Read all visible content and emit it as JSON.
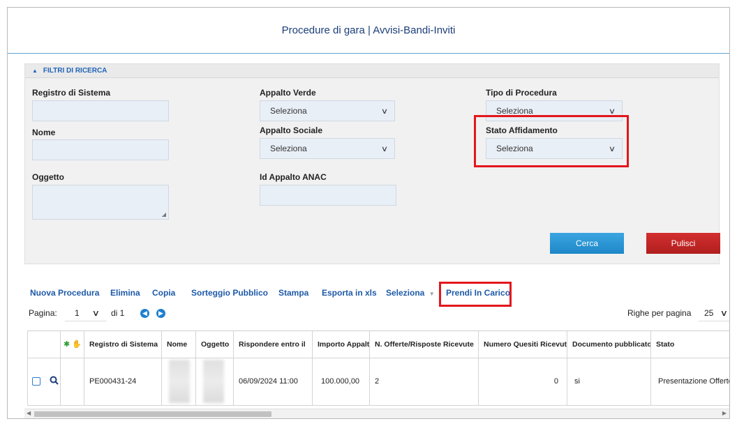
{
  "page_title": "Procedure di gara | Avvisi-Bandi-Inviti",
  "filters": {
    "header": "FILTRI DI RICERCA",
    "registro_label": "Registro di Sistema",
    "nome_label": "Nome",
    "oggetto_label": "Oggetto",
    "appalto_verde_label": "Appalto Verde",
    "appalto_verde_value": "Seleziona",
    "appalto_sociale_label": "Appalto Sociale",
    "appalto_sociale_value": "Seleziona",
    "id_anac_label": "Id Appalto ANAC",
    "tipo_procedura_label": "Tipo di Procedura",
    "tipo_procedura_value": "Seleziona",
    "stato_affidamento_label": "Stato Affidamento",
    "stato_affidamento_value": "Seleziona",
    "cerca_label": "Cerca",
    "pulisci_label": "Pulisci"
  },
  "toolbar": {
    "nuova": "Nuova Procedura",
    "elimina": "Elimina",
    "copia": "Copia",
    "sorteggio": "Sorteggio Pubblico",
    "stampa": "Stampa",
    "esporta": "Esporta in xls",
    "seleziona": "Seleziona",
    "prendi": "Prendi In Carico"
  },
  "pager": {
    "label": "Pagina:",
    "page": "1",
    "of": "di 1",
    "rows_label": "Righe per pagina",
    "rows_value": "25"
  },
  "table": {
    "columns": [
      "Registro di Sistema",
      "Nome",
      "Oggetto",
      "Rispondere entro il",
      "Importo Appalto",
      "N. Offerte/Risposte Ricevute",
      "Numero Quesiti Ricevuti",
      "Documento pubblicato",
      "Stato"
    ],
    "row": {
      "registro": "PE000431-24",
      "rispondere": "06/09/2024 11:00",
      "importo": "100.000,00",
      "offerte": "2",
      "quesiti": "0",
      "documento": "si",
      "stato": "Presentazione Offerte/R"
    }
  },
  "colors": {
    "accent_blue": "#1e5aa8",
    "cerca": "#1e86c8",
    "pulisci": "#b01e1e",
    "highlight": "#e3161c"
  }
}
